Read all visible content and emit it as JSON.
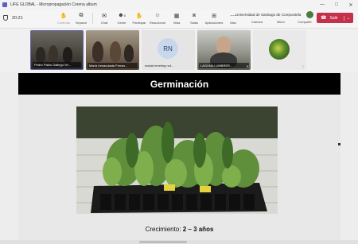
{
  "window": {
    "title": "LIFE GLOBAL - Micropropagación Corena album",
    "minimize": "—",
    "maximize": "□",
    "close": "✕"
  },
  "toolbar": {
    "timer": "20:21",
    "items": [
      {
        "label": "Controlar",
        "icon": "controller-icon",
        "glyph": "✋"
      },
      {
        "label": "Separar",
        "icon": "separate-icon",
        "glyph": "⧉"
      },
      {
        "label": "Chat",
        "icon": "chat-icon",
        "glyph": "💬"
      },
      {
        "label": "Gente",
        "icon": "people-icon",
        "glyph": "👥",
        "count": "5"
      },
      {
        "label": "Participar",
        "icon": "raise-hand-icon",
        "glyph": "✋"
      },
      {
        "label": "Reaccionar",
        "icon": "react-icon",
        "glyph": "☺"
      },
      {
        "label": "Vista",
        "icon": "view-icon",
        "glyph": "▦"
      },
      {
        "label": "Salas",
        "icon": "rooms-icon",
        "glyph": "⧈"
      },
      {
        "label": "Aplicaciones",
        "icon": "apps-icon",
        "glyph": "⊞"
      },
      {
        "label": "Más",
        "icon": "more-icon",
        "glyph": "⋯"
      },
      {
        "label": "Cámara",
        "icon": "camera-icon",
        "glyph": "▶"
      },
      {
        "label": "Micro",
        "icon": "mic-icon",
        "glyph": "🎙"
      },
      {
        "label": "Compartir",
        "icon": "share-icon",
        "glyph": "⇪"
      }
    ],
    "organization": "Universidad de Santiago de Compostela",
    "leave_label": "Salir"
  },
  "participants": [
    {
      "name": "Pedro Pablo Gallego Ve..."
    },
    {
      "name": "María Inmaculada Ferran..."
    },
    {
      "name": "madal meeting not...",
      "initials": "RN"
    },
    {
      "name": "LAGUNA LUMBRER..."
    },
    {
      "name": ""
    }
  ],
  "slide": {
    "title": "Germinación",
    "caption_prefix": "Crecimiento:",
    "caption_value": "2 – 3 años"
  },
  "colors": {
    "accent": "#6264a7",
    "leave": "#c4314b",
    "slide_header": "#000000"
  }
}
